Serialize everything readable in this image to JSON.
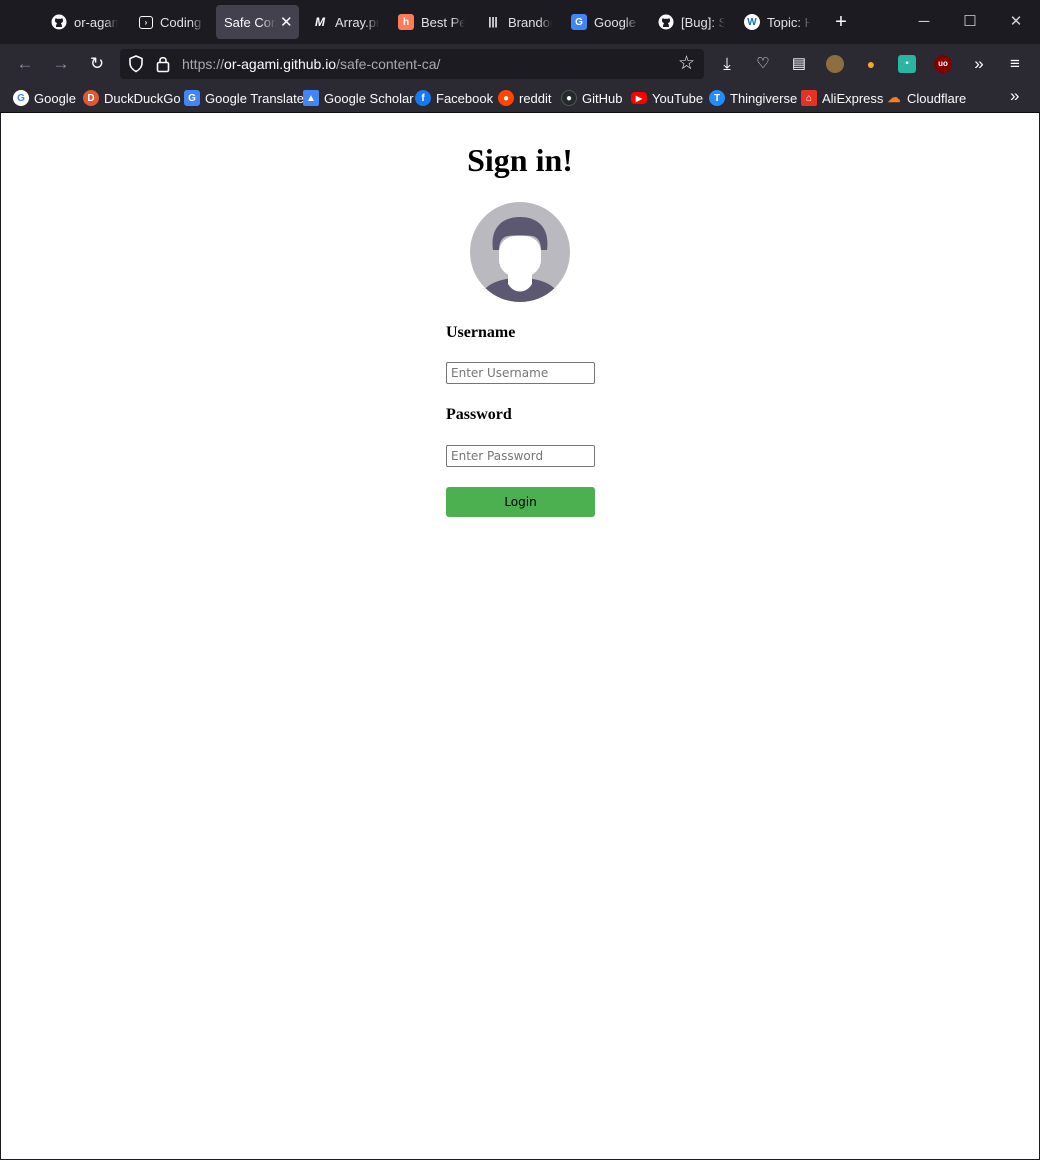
{
  "tabs": [
    {
      "label": "or-agami",
      "icon": "github-icon"
    },
    {
      "label": "Coding",
      "icon": "terminal-icon"
    },
    {
      "label": "Safe Cont",
      "icon": "",
      "active": true
    },
    {
      "label": "Array.pr",
      "icon": "m-icon"
    },
    {
      "label": "Best Per",
      "icon": "hubspot-icon"
    },
    {
      "label": "Brandon",
      "icon": "bars-icon"
    },
    {
      "label": "Google T",
      "icon": "google-translate-icon"
    },
    {
      "label": "[Bug]: S",
      "icon": "github-icon"
    },
    {
      "label": "Topic: H",
      "icon": "wordpress-icon"
    }
  ],
  "url": {
    "prefix": "https://",
    "host": "or-agami.github.io",
    "path": "/safe-content-ca/"
  },
  "bookmarks": [
    {
      "label": "Google",
      "color": "#ffffff"
    },
    {
      "label": "DuckDuckGo",
      "color": "#de5833"
    },
    {
      "label": "Google Translate",
      "color": "#4285f4"
    },
    {
      "label": "Google Scholar",
      "color": "#4285f4"
    },
    {
      "label": "Facebook",
      "color": "#1877f2"
    },
    {
      "label": "reddit",
      "color": "#ff4500"
    },
    {
      "label": "GitHub",
      "color": "#24292e"
    },
    {
      "label": "YouTube",
      "color": "#ff0000"
    },
    {
      "label": "Thingiverse",
      "color": "#248bfb"
    },
    {
      "label": "AliExpress",
      "color": "#e43225"
    },
    {
      "label": "Cloudflare",
      "color": "#f38020"
    }
  ],
  "page": {
    "title": "Sign in!",
    "username_label": "Username",
    "username_placeholder": "Enter Username",
    "password_label": "Password",
    "password_placeholder": "Enter Password",
    "login_label": "Login"
  },
  "colors": {
    "login_button": "#4caf50",
    "toolbar": "#2b2a33",
    "tabstrip": "#1c1b22"
  }
}
